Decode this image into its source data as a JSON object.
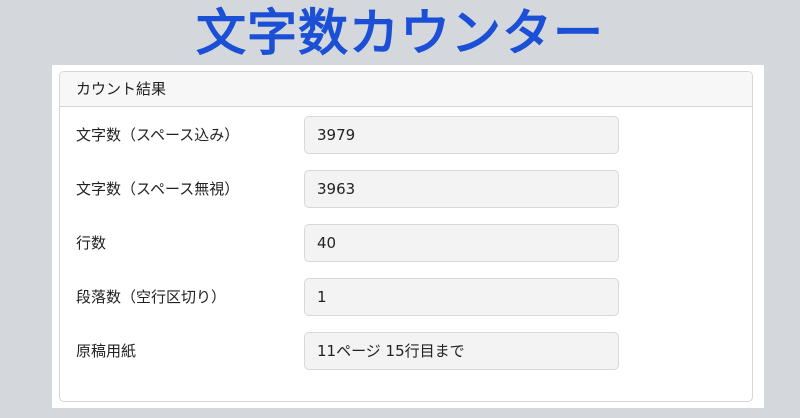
{
  "banner": {
    "title": "文字数カウンター"
  },
  "result": {
    "header": "カウント結果",
    "rows": [
      {
        "label": "文字数（スペース込み）",
        "value": "3979"
      },
      {
        "label": "文字数（スペース無視）",
        "value": "3963"
      },
      {
        "label": "行数",
        "value": "40"
      },
      {
        "label": "段落数（空行区切り）",
        "value": "1"
      },
      {
        "label": "原稿用紙",
        "value": "11ページ 15行目まで"
      }
    ]
  },
  "colors": {
    "title": "#1a4fd6",
    "background": "#d4d7dc",
    "field_background": "#f3f3f3"
  }
}
